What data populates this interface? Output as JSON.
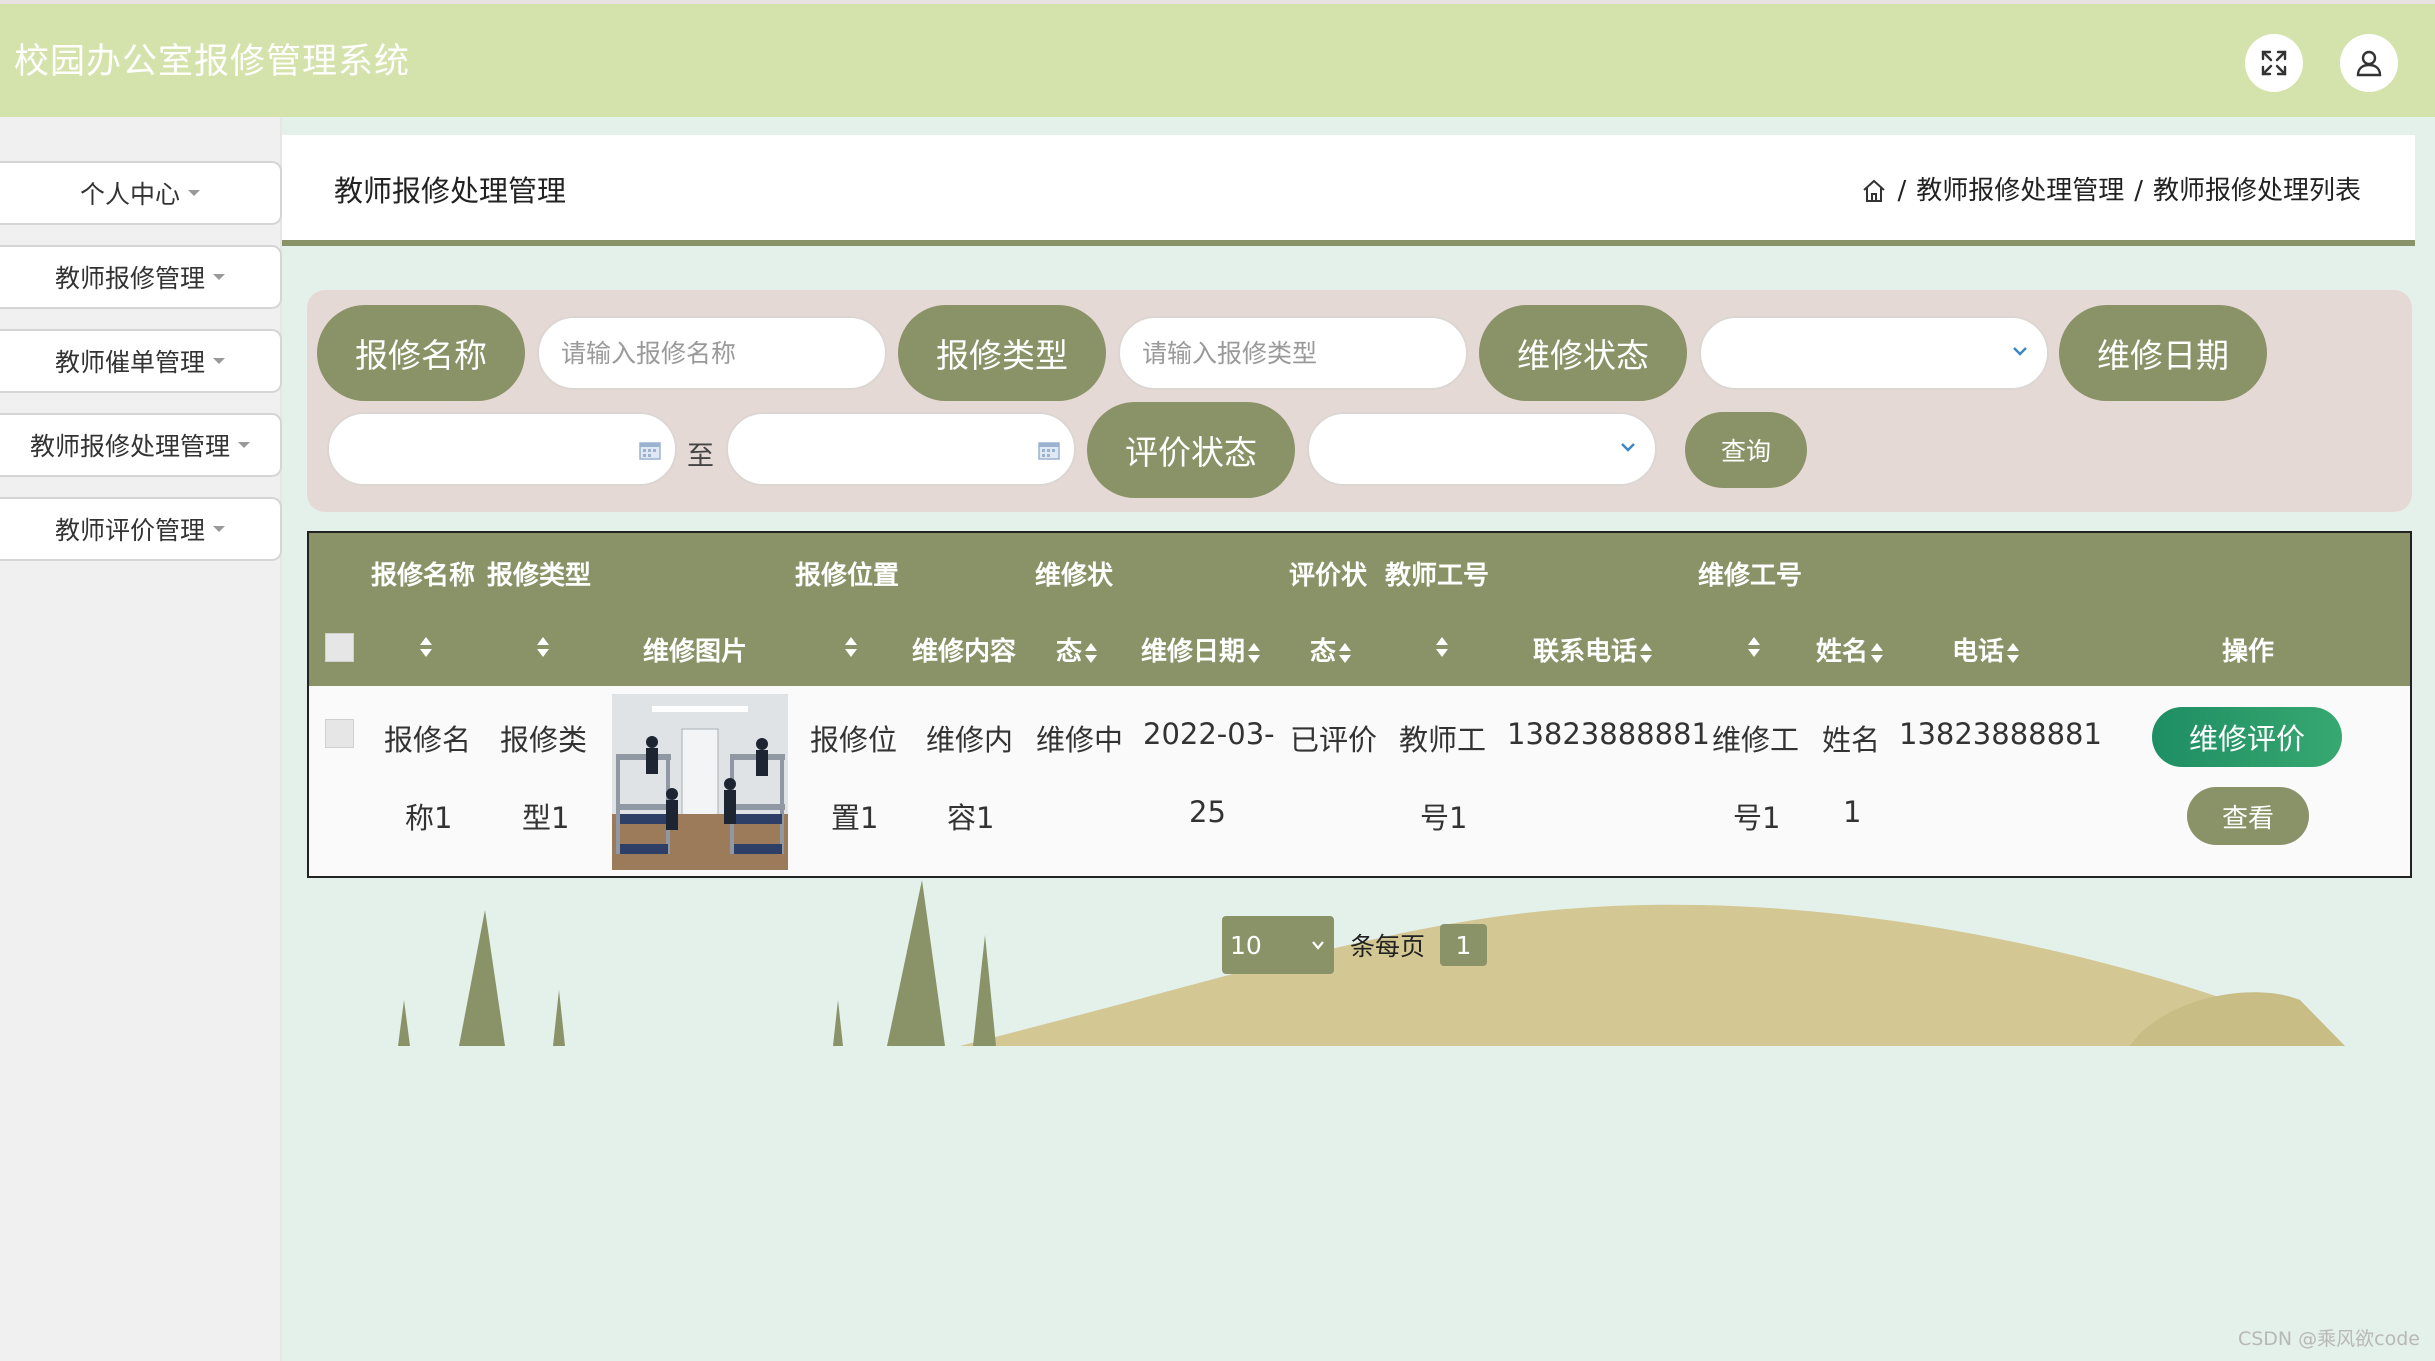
{
  "app": {
    "title": "校园办公室报修管理系统"
  },
  "header": {
    "fullscreen_icon": "expand-icon",
    "user_icon": "user-icon"
  },
  "sidebar": {
    "items": [
      {
        "label": "个人中心"
      },
      {
        "label": "教师报修管理"
      },
      {
        "label": "教师催单管理"
      },
      {
        "label": "教师报修处理管理"
      },
      {
        "label": "教师评价管理"
      }
    ]
  },
  "page": {
    "title": "教师报修处理管理",
    "breadcrumb": {
      "home_icon": "home-icon",
      "sep": "/",
      "level1": "教师报修处理管理",
      "level2": "教师报修处理列表"
    }
  },
  "search": {
    "name_label": "报修名称",
    "name_placeholder": "请输入报修名称",
    "type_label": "报修类型",
    "type_placeholder": "请输入报修类型",
    "status_label": "维修状态",
    "status_value": "",
    "date_label": "维修日期",
    "date_to": "至",
    "eval_label": "评价状态",
    "eval_value": "",
    "query_button": "查询"
  },
  "table": {
    "headers": {
      "name": "报修名称",
      "type": "报修类型",
      "image": "维修图片",
      "location": "报修位置",
      "content": "维修内容",
      "status_a": "维修状",
      "status_b": "态",
      "date": "维修日期",
      "eval_a": "评价状",
      "eval_b": "态",
      "teacher_id": "教师工号",
      "phone": "联系电话",
      "worker_id": "维修工号",
      "name2": "姓名",
      "phone2": "电话",
      "actions": "操作"
    },
    "rows": [
      {
        "name_1": "报修名",
        "name_2": "称1",
        "type_1": "报修类",
        "type_2": "型1",
        "location_1": "报修位",
        "location_2": "置1",
        "content_1": "维修内",
        "content_2": "容1",
        "status": "维修中",
        "date_1": "2022-03-",
        "date_2": "25",
        "eval": "已评价",
        "teacher_1": "教师工",
        "teacher_2": "号1",
        "phone": "13823888881",
        "worker_1": "维修工",
        "worker_2": "号1",
        "name2_1": "姓名",
        "name2_2": "1",
        "phone2": "13823888881",
        "eval_button": "维修评价",
        "view_button": "查看"
      }
    ]
  },
  "pagination": {
    "page_size": "10",
    "per_page_label": "条每页",
    "current_page": "1"
  },
  "watermark": "CSDN @乘风欲code",
  "colors": {
    "header_bg": "#d4e3ab",
    "accent": "#8a9267",
    "panel_bg": "#e5d9d6",
    "eval_btn": "#1e8e64",
    "page_bg": "#e4f0ea"
  }
}
